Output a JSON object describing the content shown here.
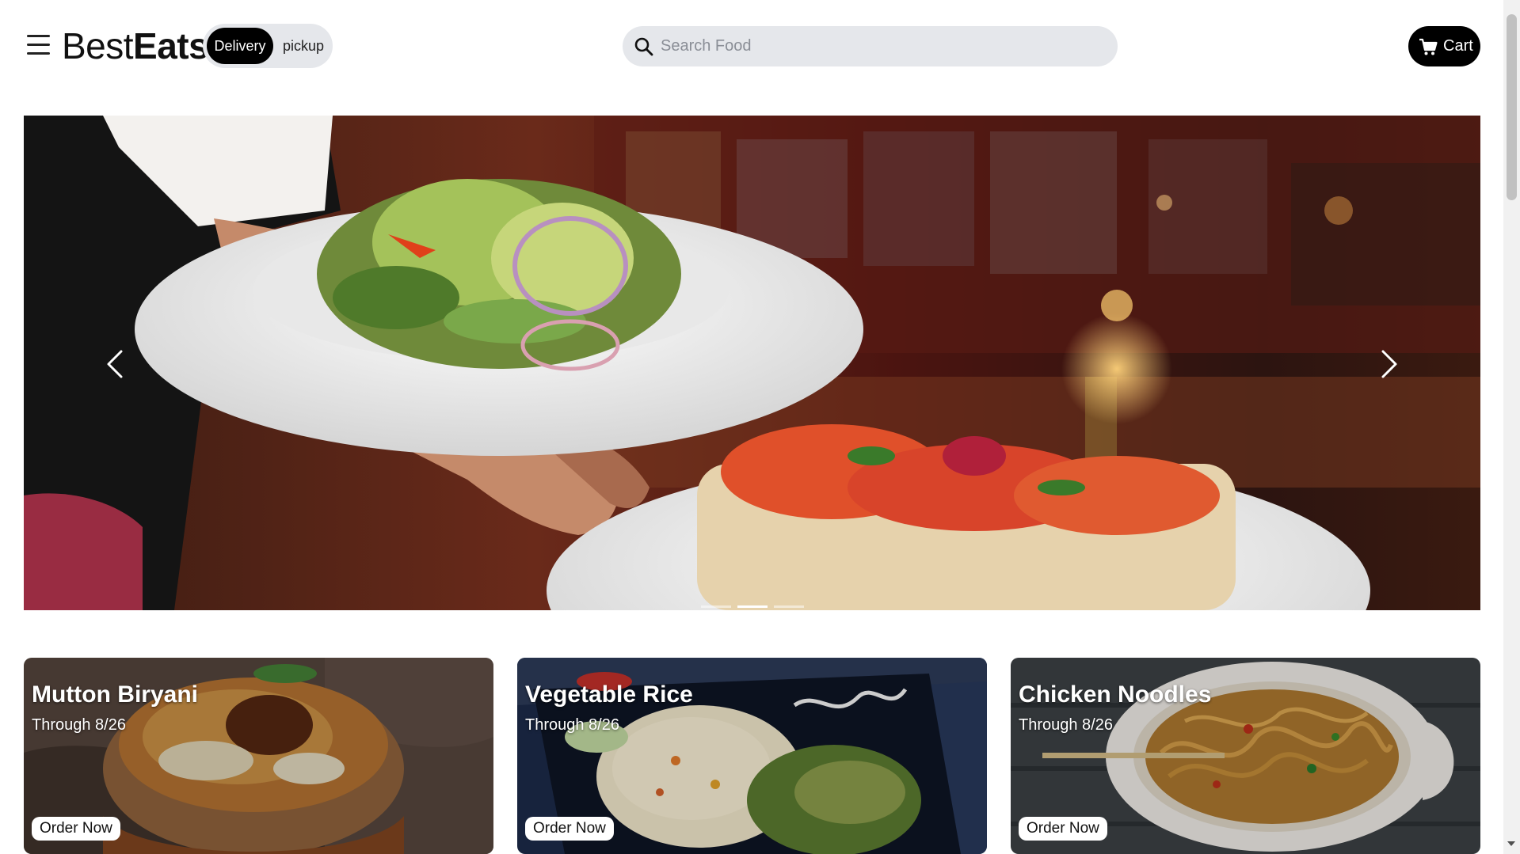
{
  "header": {
    "menu_icon": "hamburger-menu-icon",
    "logo": {
      "light": "Best",
      "bold": "Eats"
    },
    "mode_toggle": {
      "active": "Delivery",
      "inactive": "pickup"
    },
    "search": {
      "placeholder": "Search Food",
      "value": "",
      "icon": "search-icon"
    },
    "cart": {
      "label": "Cart",
      "icon": "cart-icon"
    }
  },
  "hero": {
    "prev_icon": "chevron-left-icon",
    "next_icon": "chevron-right-icon",
    "slide_count": 3,
    "active_slide": 2
  },
  "promos": [
    {
      "title": "Mutton Biryani",
      "subtitle": "Through 8/26",
      "button": "Order Now"
    },
    {
      "title": "Vegetable Rice",
      "subtitle": "Through 8/26",
      "button": "Order Now"
    },
    {
      "title": "Chicken Noodles",
      "subtitle": "Through 8/26",
      "button": "Order Now"
    }
  ],
  "colors": {
    "primary": "#000000",
    "pill_bg": "#e5e7eb",
    "page_bg": "#ffffff"
  }
}
